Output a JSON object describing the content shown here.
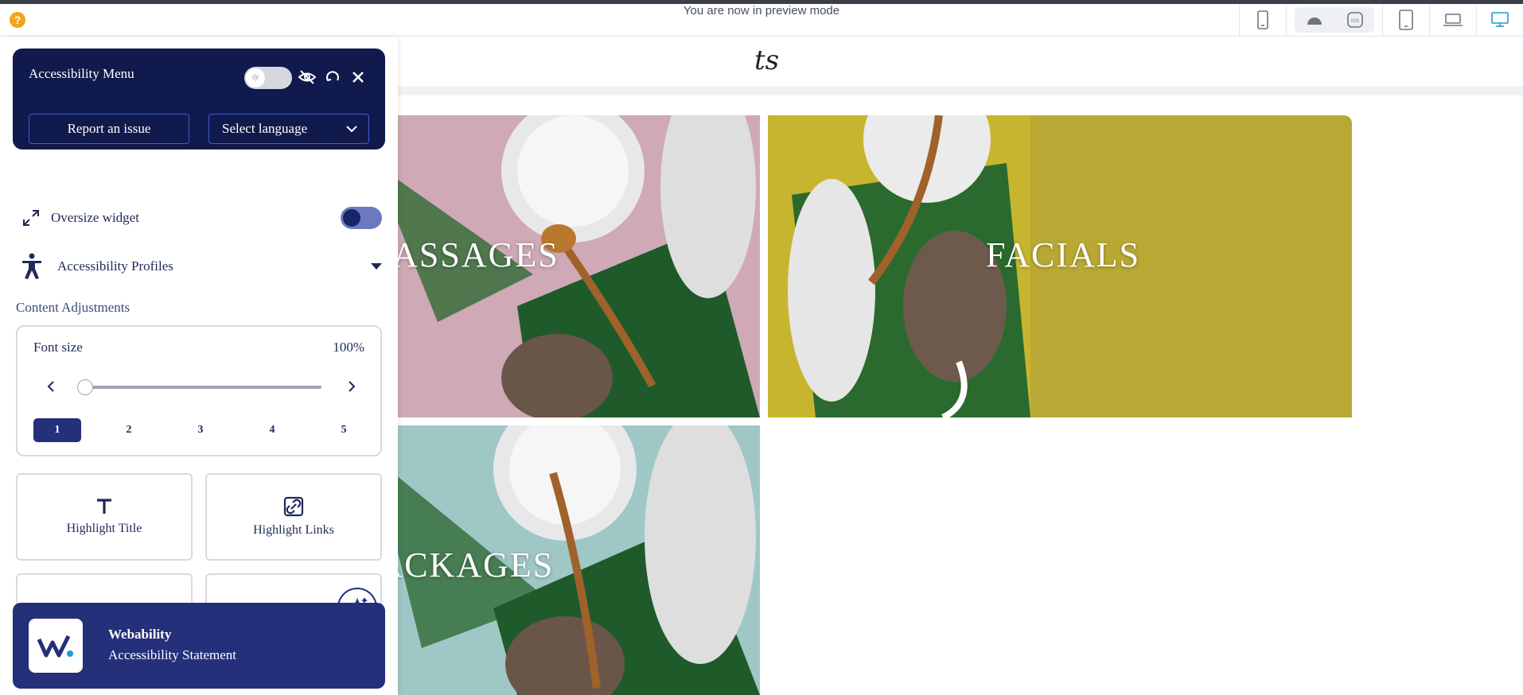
{
  "preview_bar": {
    "help_glyph": "?",
    "message": "You are now in preview mode",
    "devices": [
      "mobile-icon",
      "android-icon",
      "ios-icon",
      "tablet-icon",
      "laptop-icon",
      "desktop-icon"
    ],
    "ios_label": "iOS",
    "active_device": "desktop-icon"
  },
  "site": {
    "logo_text": "ts",
    "tiles": [
      {
        "label": "MASSAGES"
      },
      {
        "label": "FACIALS"
      },
      {
        "label": "PACKAGES"
      }
    ]
  },
  "accessibility": {
    "title": "Accessibility Menu",
    "report_label": "Report an issue",
    "language_label": "Select language",
    "oversize_label": "Oversize widget",
    "profiles_label": "Accessibility Profiles",
    "section_title": "Content Adjustments",
    "font_size": {
      "label": "Font size",
      "value": "100%",
      "level": 0.0,
      "steps": [
        "1",
        "2",
        "3",
        "4",
        "5"
      ],
      "active_step": "1"
    },
    "tools": [
      {
        "label": "Highlight Title",
        "icon": "title-icon"
      },
      {
        "label": "Highlight Links",
        "icon": "link-icon"
      }
    ],
    "footer": {
      "name": "Webability",
      "statement": "Accessibility Statement"
    }
  },
  "colors": {
    "panel_dark": "#111a4c",
    "accent": "#24307a",
    "device_active": "#1e9ad6"
  }
}
